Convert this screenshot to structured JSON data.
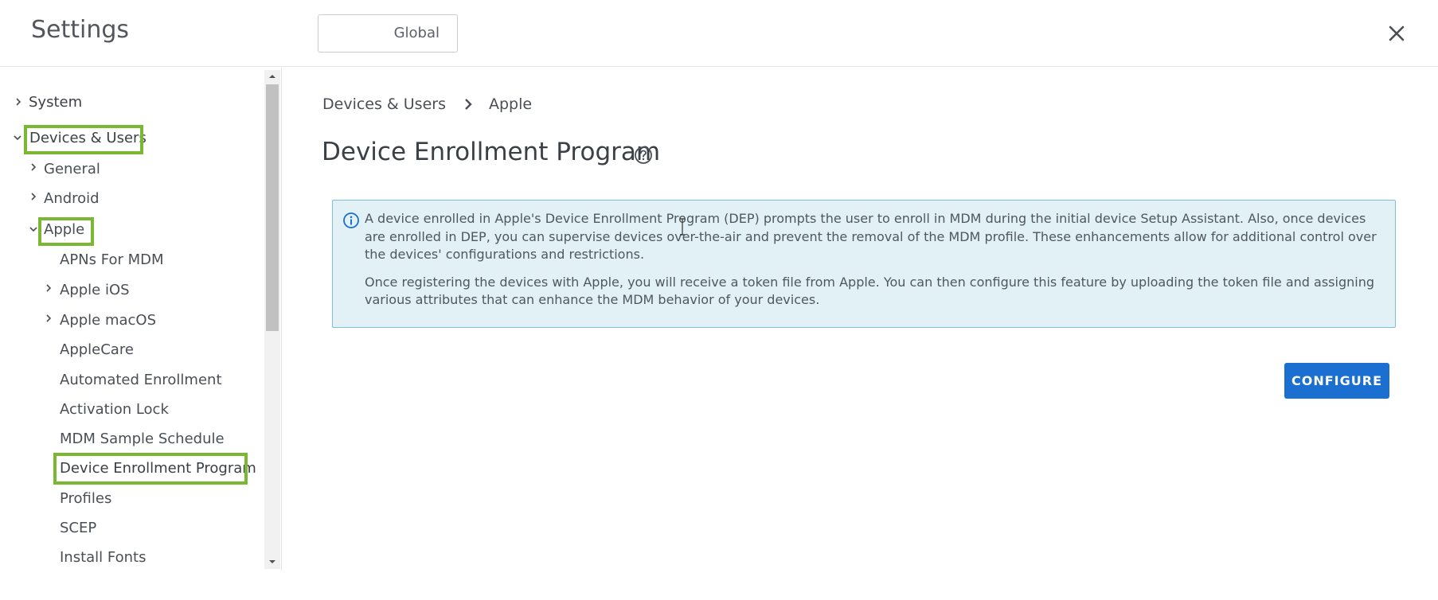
{
  "header": {
    "title": "Settings",
    "scope_value": "Global"
  },
  "sidebar": {
    "items": [
      {
        "label": "System"
      },
      {
        "label": "Devices & Users"
      },
      {
        "label": "General"
      },
      {
        "label": "Android"
      },
      {
        "label": "Apple"
      },
      {
        "label": "APNs For MDM"
      },
      {
        "label": "Apple iOS"
      },
      {
        "label": "Apple macOS"
      },
      {
        "label": "AppleCare"
      },
      {
        "label": "Automated Enrollment"
      },
      {
        "label": "Activation Lock"
      },
      {
        "label": "MDM Sample Schedule"
      },
      {
        "label": "Device Enrollment Program"
      },
      {
        "label": "Profiles"
      },
      {
        "label": "SCEP"
      },
      {
        "label": "Install Fonts"
      }
    ]
  },
  "main": {
    "breadcrumb": [
      "Devices & Users",
      "Apple"
    ],
    "title": "Device Enrollment Program",
    "info": {
      "paragraph1": "A device enrolled in Apple's Device Enrollment Program (DEP) prompts the user to enroll in MDM during the initial device Setup Assistant. Also, once devices are enrolled in DEP, you can supervise devices over-the-air and prevent the removal of the MDM profile. These enhancements allow for additional control over the devices' configurations and restrictions.",
      "paragraph2": "Once registering the devices with Apple, you will receive a token file from Apple. You can then configure this feature by uploading the token file and assigning various attributes that can enhance the MDM behavior of your devices."
    },
    "configure_label": "CONFIGURE"
  },
  "colors": {
    "accent": "#1a6fd0",
    "highlight": "#7ab833",
    "info_bg": "#e1f1f6",
    "info_border": "#7dc0d9"
  }
}
